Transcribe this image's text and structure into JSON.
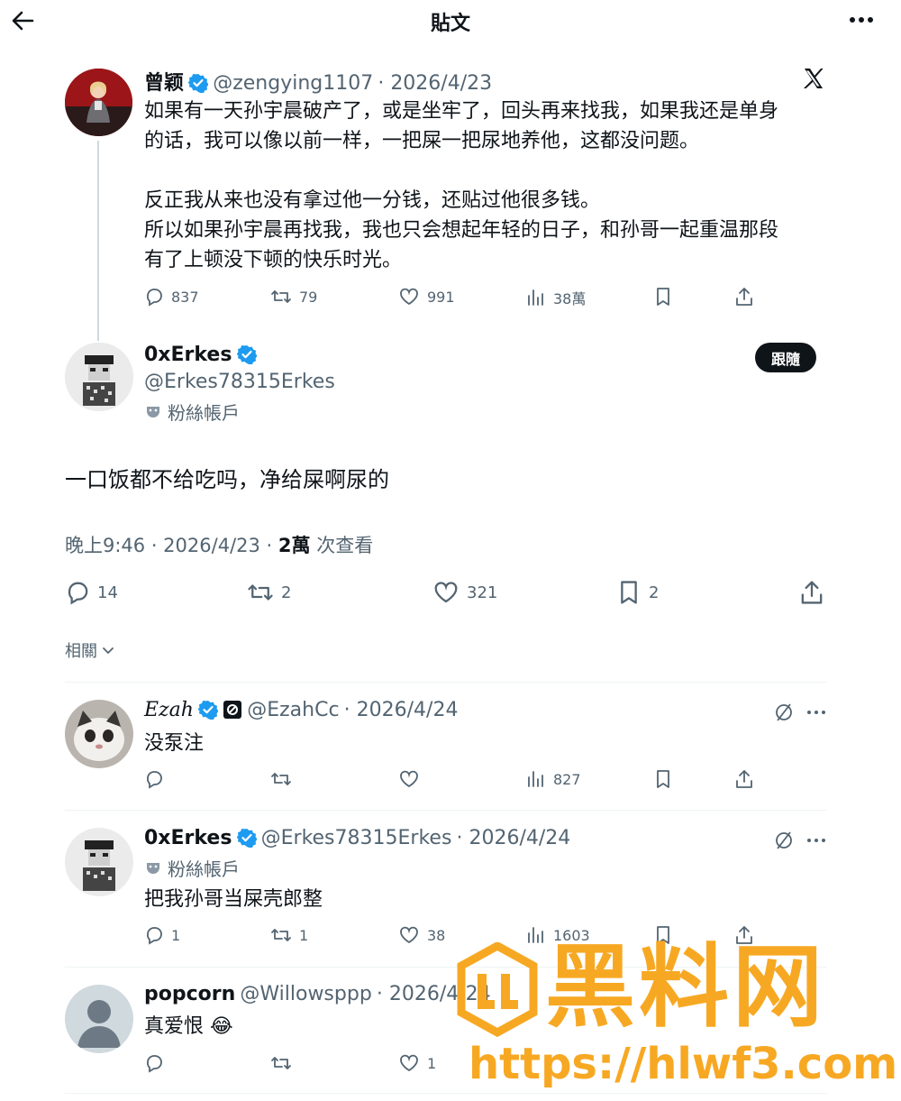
{
  "header": {
    "title": "貼文"
  },
  "quoted": {
    "name": "曾颖",
    "handle": "@zengying1107",
    "date": "· 2026/4/23",
    "text_lines": [
      "如果有一天孙宇晨破产了，或是坐牢了，回头再来找我，如果我还是单身",
      "的话，我可以像以前一样，一把屎一把尿地养他，这都没问题。",
      "反正我从来也没有拿过他一分钱，还贴过他很多钱。",
      "所以如果孙宇晨再找我，我也只会想起年轻的日子，和孙哥一起重温那段",
      "有了上顿没下顿的快乐时光。"
    ],
    "replies": "837",
    "reposts": "79",
    "likes": "991",
    "views": "38萬",
    "logo": "x-logo-icon"
  },
  "main": {
    "name": "0xErkes",
    "handle": "@Erkes78315Erkes",
    "badge": "粉絲帳戶",
    "follow_label": "跟隨",
    "text": "一口饭都不给吃吗，净给屎啊尿的",
    "time": "晚上9:46 · 2026/4/23 · ",
    "views_count": "2萬",
    "views_label": " 次查看",
    "replies": "14",
    "reposts": "2",
    "likes": "321",
    "bookmarks": "2"
  },
  "related": {
    "label": "相關"
  },
  "replies": [
    {
      "name": "Ezah",
      "handle": "@EzahCc",
      "date": "· 2026/4/24",
      "text": "没泵注",
      "replies": "",
      "reposts": "",
      "likes": "",
      "views": "827"
    },
    {
      "name": "0xErkes",
      "handle": "@Erkes78315Erkes",
      "date": "· 2026/4/24",
      "badge": "粉絲帳戶",
      "text": "把我孙哥当屎壳郎整",
      "replies": "1",
      "reposts": "1",
      "likes": "38",
      "views": "1603"
    },
    {
      "name": "popcorn",
      "handle": "@Willowsppp",
      "date": "· 2026/4/24",
      "text": "真爱恨 😂",
      "replies": "",
      "reposts": "",
      "likes": "1",
      "views": ""
    }
  ],
  "watermark": {
    "brand": "黑料网",
    "url": "https://hlwf3.com"
  },
  "colors": {
    "verified": "#1d9bf0",
    "text": "#0f1419",
    "muted": "#536471",
    "watermark": "#f7a823"
  }
}
